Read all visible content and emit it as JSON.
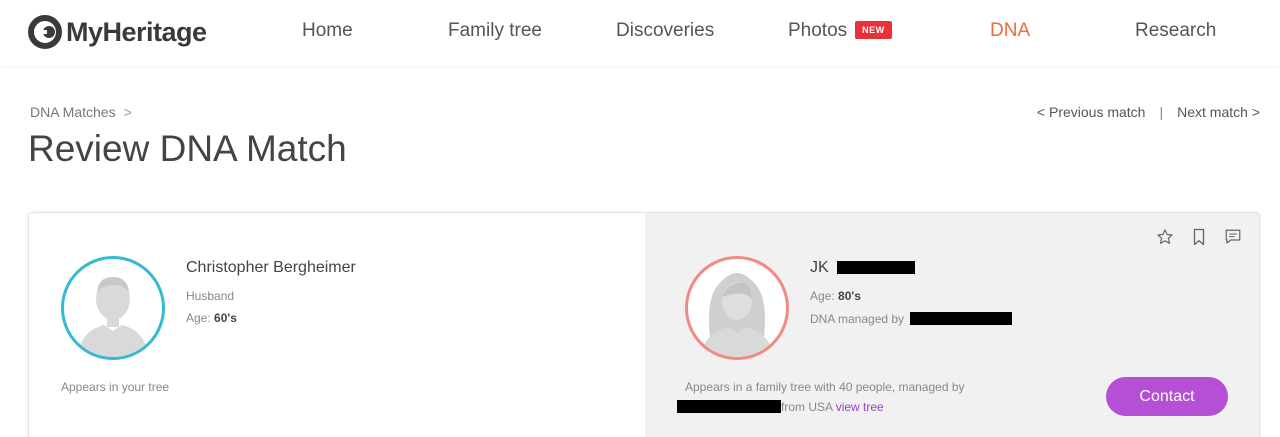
{
  "header": {
    "logo_text": "MyHeritage",
    "nav": [
      {
        "label": "Home"
      },
      {
        "label": "Family tree"
      },
      {
        "label": "Discoveries"
      },
      {
        "label": "Photos",
        "badge": "NEW"
      },
      {
        "label": "DNA",
        "active": true
      },
      {
        "label": "Research"
      }
    ],
    "accent_color": "#f06a3c",
    "badge_color": "#e8313a"
  },
  "breadcrumb": {
    "item": "DNA Matches",
    "separator": ">"
  },
  "page_title": "Review DNA Match",
  "match_nav": {
    "previous": "<  Previous match",
    "divider": "|",
    "next": "Next match  >"
  },
  "left_person": {
    "name": "Christopher Bergheimer",
    "relation": "Husband",
    "age_label": "Age:",
    "age_value": "60's",
    "footer": "Appears in your tree",
    "ring_color": "#36b9d3",
    "avatar_icon": "male-silhouette-icon"
  },
  "right_person": {
    "name": "JK",
    "age_label": "Age:",
    "age_value": "80's",
    "managed_label": "DNA managed by",
    "footer_line1": "Appears in a family tree with 40 people, managed by",
    "footer_from": "from USA",
    "view_tree": "view tree",
    "ring_color": "#ef8a84",
    "avatar_icon": "female-silhouette-icon"
  },
  "actions": {
    "icons": [
      "star-icon",
      "bookmark-icon",
      "comment-icon"
    ],
    "contact_label": "Contact",
    "contact_color": "#b44fd6"
  }
}
